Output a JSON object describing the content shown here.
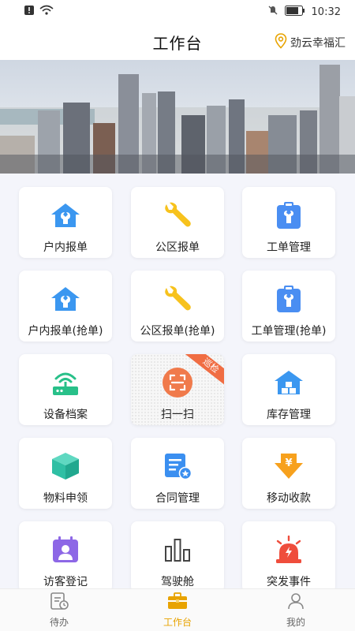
{
  "status_bar": {
    "time": "10:32"
  },
  "header": {
    "title": "工作台",
    "location": "劲云幸福汇"
  },
  "colors": {
    "accent": "#e8a300",
    "blue": "#3b97f0",
    "yellow": "#f7c21d",
    "green": "#28c089",
    "orange": "#f07a4b",
    "purple": "#8d67e6",
    "red": "#ef4d3c"
  },
  "tiles": [
    {
      "label": "户内报单",
      "icon": "house-wrench-icon"
    },
    {
      "label": "公区报单",
      "icon": "wrench-icon"
    },
    {
      "label": "工单管理",
      "icon": "clipboard-wrench-icon"
    },
    {
      "label": "户内报单(抢单)",
      "icon": "house-wrench-icon"
    },
    {
      "label": "公区报单(抢单)",
      "icon": "wrench-icon"
    },
    {
      "label": "工单管理(抢单)",
      "icon": "clipboard-wrench-icon"
    },
    {
      "label": "设备档案",
      "icon": "router-icon"
    },
    {
      "label": "扫一扫",
      "icon": "scan-icon",
      "ribbon": "巡检"
    },
    {
      "label": "库存管理",
      "icon": "warehouse-icon"
    },
    {
      "label": "物料申领",
      "icon": "box-icon"
    },
    {
      "label": "合同管理",
      "icon": "contract-icon"
    },
    {
      "label": "移动收款",
      "icon": "yen-receive-icon"
    },
    {
      "label": "访客登记",
      "icon": "visitor-icon"
    },
    {
      "label": "驾驶舱",
      "icon": "bar-chart-icon"
    },
    {
      "label": "突发事件",
      "icon": "alarm-icon"
    }
  ],
  "tabbar": [
    {
      "label": "待办",
      "icon": "todo-icon",
      "active": false
    },
    {
      "label": "工作台",
      "icon": "briefcase-icon",
      "active": true
    },
    {
      "label": "我的",
      "icon": "profile-icon",
      "active": false
    }
  ]
}
